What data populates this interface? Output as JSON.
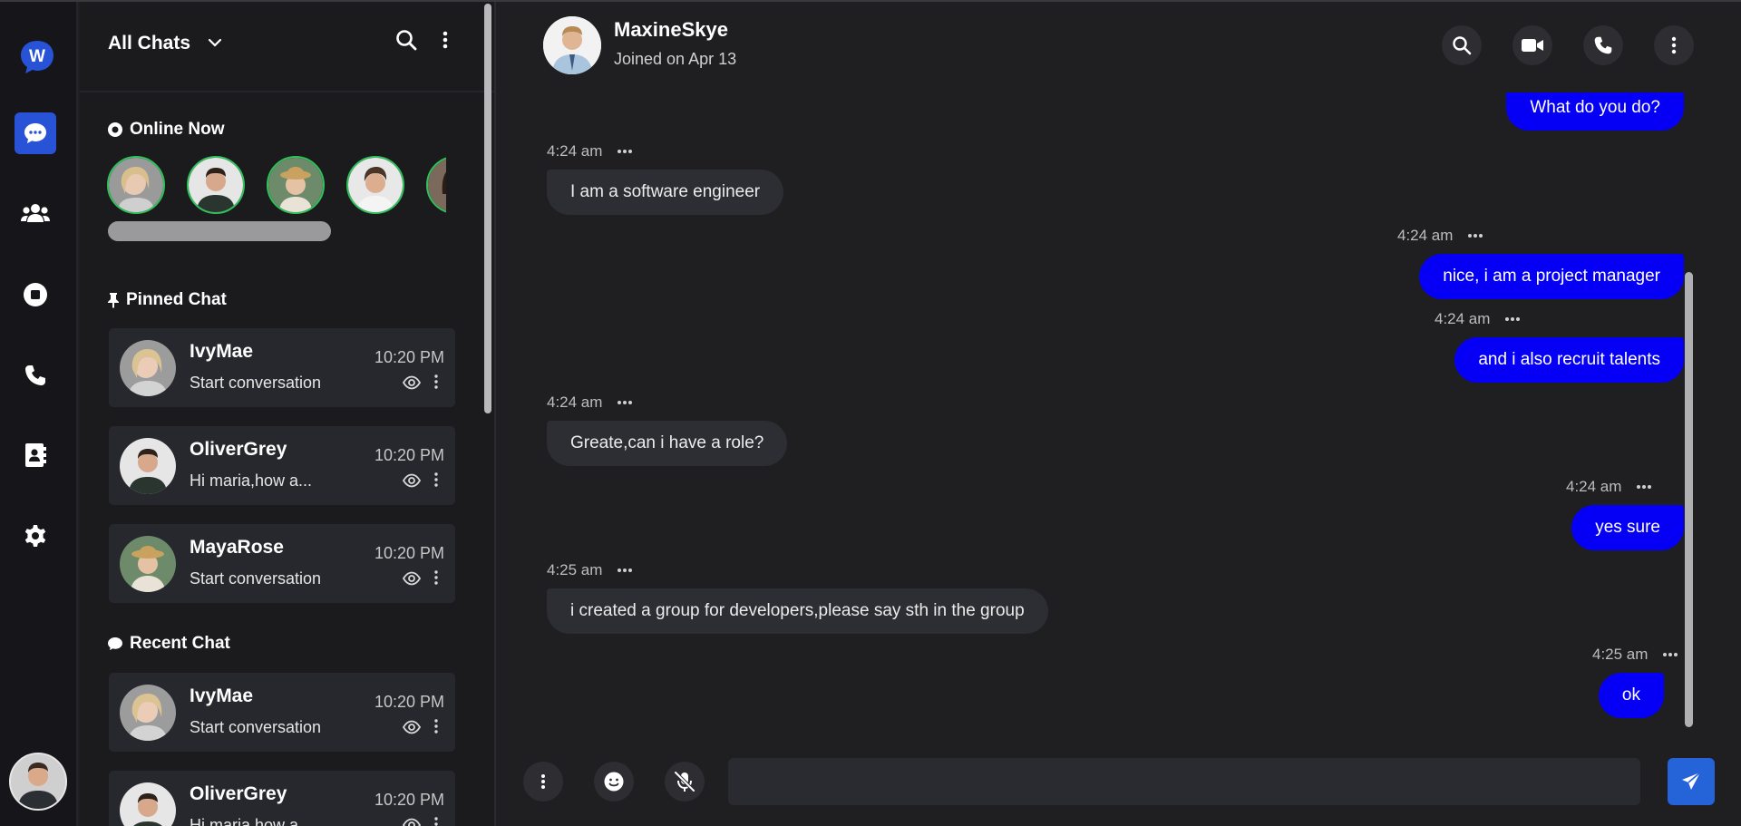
{
  "sidebar": {
    "logo_letter": "W",
    "items": [
      {
        "icon": "chat-icon",
        "active": true
      },
      {
        "icon": "users-icon",
        "active": false
      },
      {
        "icon": "stop-circle-icon",
        "active": false
      },
      {
        "icon": "phone-icon",
        "active": false
      },
      {
        "icon": "contacts-icon",
        "active": false
      },
      {
        "icon": "gear-icon",
        "active": false
      }
    ]
  },
  "chat_list": {
    "title": "All Chats",
    "online_title": "Online Now",
    "pinned_title": "Pinned Chat",
    "recent_title": "Recent Chat",
    "pinned": [
      {
        "name": "IvyMae",
        "preview": "Start conversation",
        "time": "10:20 PM"
      },
      {
        "name": "OliverGrey",
        "preview": "Hi maria,how a...",
        "time": "10:20 PM"
      },
      {
        "name": "MayaRose",
        "preview": "Start conversation",
        "time": "10:20 PM"
      }
    ],
    "recent": [
      {
        "name": "IvyMae",
        "preview": "Start conversation",
        "time": "10:20 PM"
      },
      {
        "name": "OliverGrey",
        "preview": "Hi maria,how a...",
        "time": "10:20 PM"
      }
    ]
  },
  "conversation": {
    "contact_name": "MaxineSkye",
    "joined": "Joined on Apr 13",
    "partial_message": "What do you do?",
    "messages": [
      {
        "side": "in",
        "time": "4:24 am",
        "text": "I am a software engineer"
      },
      {
        "side": "out",
        "time": "4:24 am",
        "text": "nice, i am a project manager"
      },
      {
        "side": "out",
        "time": "4:24 am",
        "text": "and i also recruit talents"
      },
      {
        "side": "in",
        "time": "4:24 am",
        "text": "Greate,can i have a role?"
      },
      {
        "side": "out",
        "time": "4:24 am",
        "text": "yes sure"
      },
      {
        "side": "in",
        "time": "4:25 am",
        "text": "i created a group for developers,please say sth in the group"
      },
      {
        "side": "out",
        "time": "4:25 am",
        "text": "ok"
      }
    ],
    "composer_placeholder": ""
  },
  "colors": {
    "accent": "#2853d6",
    "outgoing_bubble": "#0500f5",
    "online_ring": "#2fc15a"
  }
}
